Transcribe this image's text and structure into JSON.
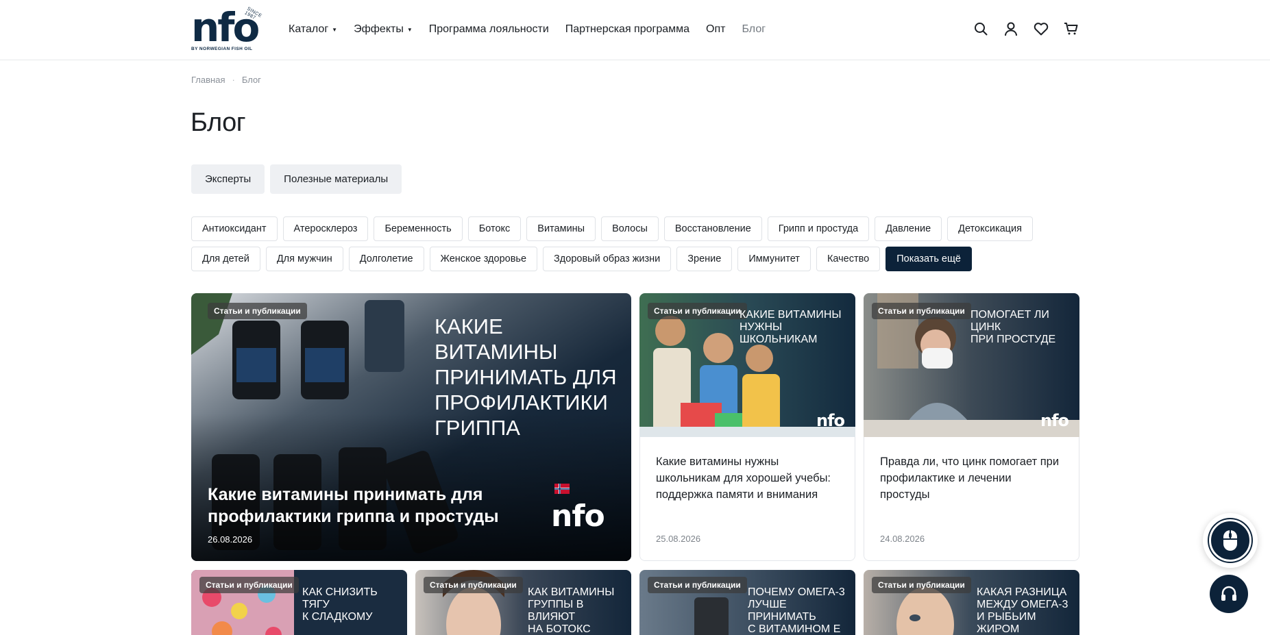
{
  "header": {
    "logo": {
      "mark": "nfo",
      "since": "SINCE 1987",
      "tagline": "BY NORWEGIAN FISH OIL"
    },
    "nav": [
      {
        "label": "Каталог",
        "dropdown": true
      },
      {
        "label": "Эффекты",
        "dropdown": true
      },
      {
        "label": "Программа лояльности",
        "dropdown": false
      },
      {
        "label": "Партнерская программа",
        "dropdown": false
      },
      {
        "label": "Опт",
        "dropdown": false
      },
      {
        "label": "Блог",
        "dropdown": false,
        "active": true
      }
    ],
    "icons": [
      "search-icon",
      "user-icon",
      "heart-icon",
      "cart-icon"
    ]
  },
  "breadcrumb": {
    "home": "Главная",
    "separator": "·",
    "current": "Блог"
  },
  "page_title": "Блог",
  "section_tabs": [
    "Эксперты",
    "Полезные материалы"
  ],
  "tags": [
    "Антиоксидант",
    "Атеросклероз",
    "Беременность",
    "Ботокс",
    "Витамины",
    "Волосы",
    "Восстановление",
    "Грипп и простуда",
    "Давление",
    "Детоксикация",
    "Для детей",
    "Для мужчин",
    "Долголетие",
    "Женское здоровье",
    "Здоровый образ жизни",
    "Зрение",
    "Иммунитет",
    "Качество"
  ],
  "show_more": "Показать ещё",
  "badge_label": "Статьи и публикации",
  "hero": {
    "image_caption": "КАКИЕ ВИТАМИНЫ\nПРИНИМАТЬ ДЛЯ\nПРОФИЛАКТИКИ\nГРИППА",
    "title": "Какие витамины принимать для профилактики гриппа и простуды",
    "date": "26.08.2026"
  },
  "cards": [
    {
      "image_caption": "КАКИЕ ВИТАМИНЫ\nНУЖНЫ ШКОЛЬНИКАМ",
      "title": "Какие витамины нужны школьникам для хорошей учебы: поддержка памяти и внимания",
      "date": "25.08.2026"
    },
    {
      "image_caption": "ПОМОГАЕТ ЛИ ЦИНК\nПРИ ПРОСТУДЕ",
      "title": "Правда ли, что цинк помогает при профилактике и лечении простуды",
      "date": "24.08.2026"
    }
  ],
  "bottom_cards": [
    {
      "image_caption": "КАК СНИЗИТЬ ТЯГУ\nК СЛАДКОМУ"
    },
    {
      "image_caption": "КАК ВИТАМИНЫ\nГРУППЫ В ВЛИЯЮТ\nНА БОТОКС"
    },
    {
      "image_caption": "ПОЧЕМУ ОМЕГА-3\nЛУЧШЕ ПРИНИМАТЬ\nС ВИТАМИНОМ Е"
    },
    {
      "image_caption": "КАКАЯ РАЗНИЦА\nМЕЖДУ ОМЕГА-3\nИ РЫБЬИМ ЖИРОМ"
    }
  ],
  "floating": [
    "scroll-mouse-icon",
    "headset-icon"
  ],
  "colors": {
    "brand_dark": "#0c2239",
    "muted": "#8a9098"
  }
}
